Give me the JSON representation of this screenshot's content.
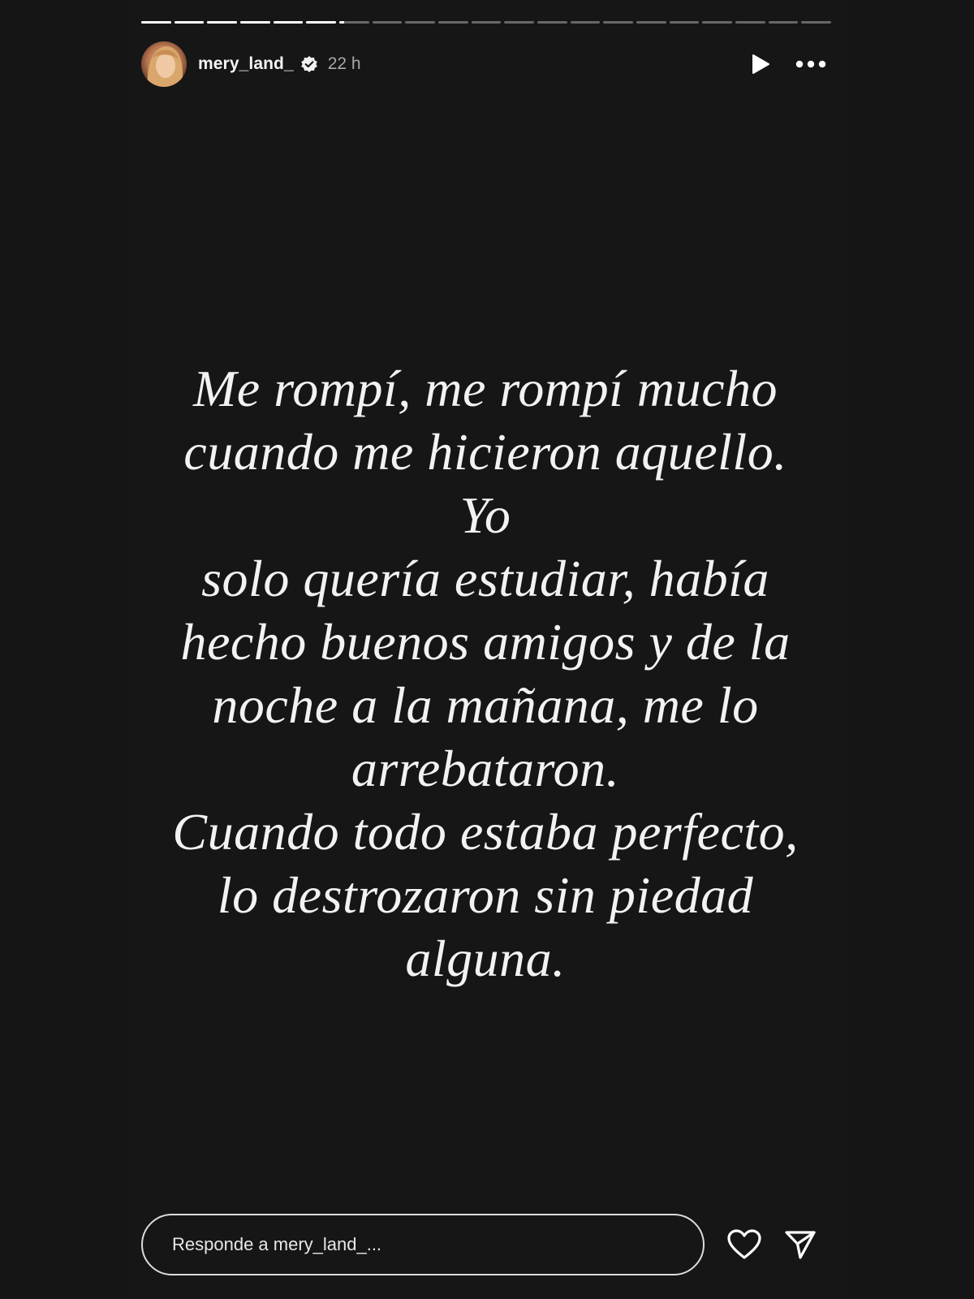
{
  "story": {
    "progress": {
      "total_segments": 21,
      "completed_segments": 6,
      "current_segment_progress": 0.15
    },
    "header": {
      "username": "mery_land_",
      "verified": true,
      "timestamp": "22 h",
      "icons": {
        "avatar": "avatar",
        "verified": "verified-badge-icon",
        "play": "play-icon",
        "more": "more-options-icon"
      }
    },
    "text": "Me rompí, me rompí mucho\ncuando me hicieron aquello. Yo\nsolo quería estudiar, había\nhecho buenos amigos y de la\nnoche a la mañana, me lo\narrebataron.\nCuando todo estaba perfecto,\nlo destrozaron sin piedad\nalguna.",
    "footer": {
      "reply_placeholder": "Responde a mery_land_...",
      "icons": {
        "like": "heart-icon",
        "share": "send-icon"
      }
    }
  },
  "colors": {
    "background": "#161616",
    "text": "#f2f2f2",
    "muted": "#a8a8a8"
  }
}
